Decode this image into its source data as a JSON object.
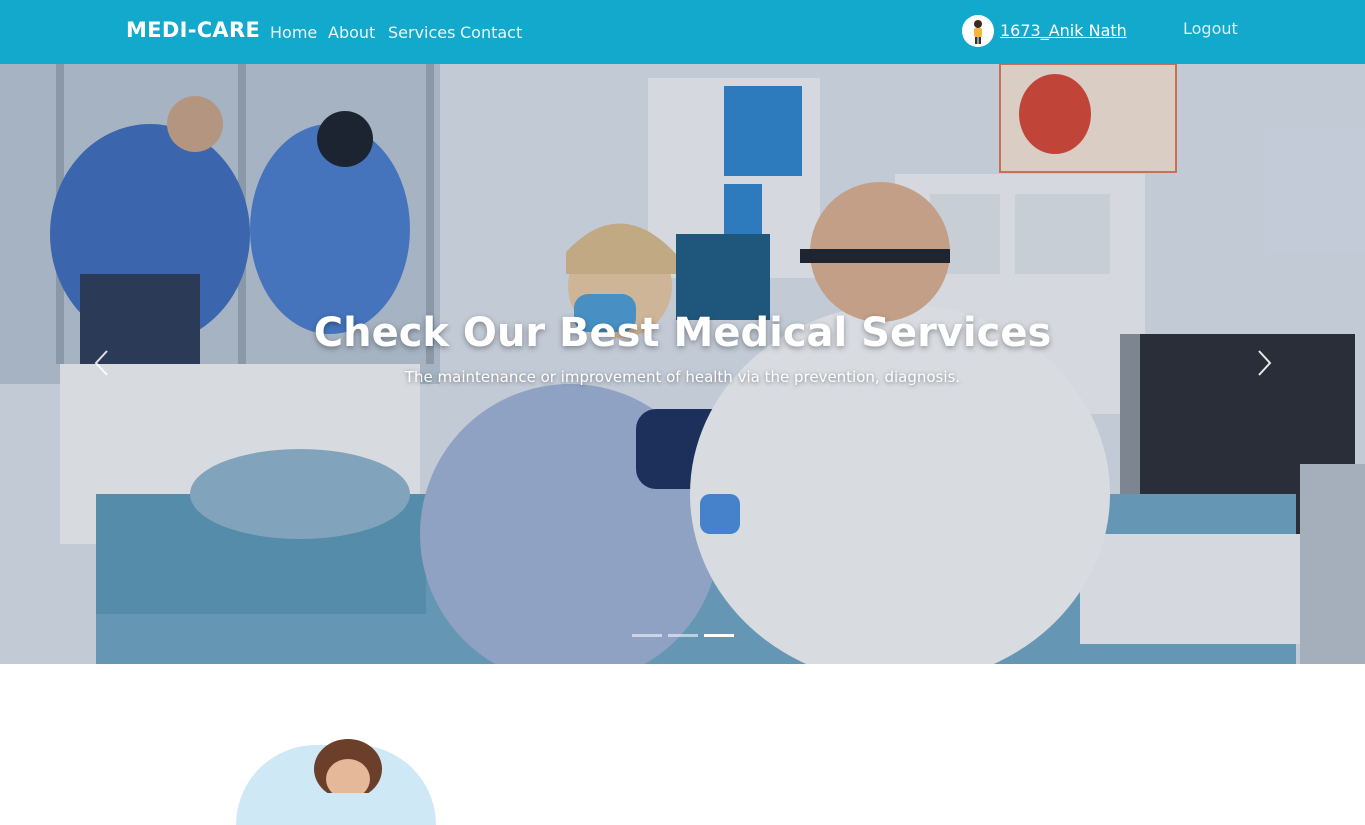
{
  "navbar": {
    "brand": "MEDI-CARE",
    "links": [
      "Home",
      "About",
      "Services",
      "Contact"
    ],
    "user_name": "1673_Anik Nath",
    "logout_label": "Logout",
    "background_color": "#12a9cc"
  },
  "hero": {
    "title": "Check Our Best Medical Services",
    "subtitle": "The maintenance or improvement of health via the prevention, diagnosis.",
    "icons": {
      "prev": "chevron-left-icon",
      "next": "chevron-right-icon"
    },
    "slide_count": 3,
    "active_slide": 3
  }
}
